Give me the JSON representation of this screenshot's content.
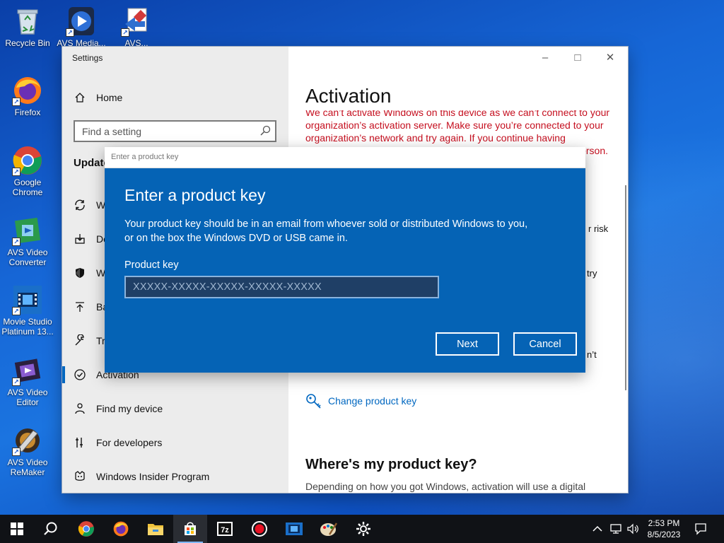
{
  "desktop": {
    "icons": [
      {
        "label": "Recycle Bin"
      },
      {
        "label": "AVS Media..."
      },
      {
        "label": "AVS..."
      },
      {
        "label": "Firefox"
      },
      {
        "label": "Google Chrome"
      },
      {
        "label": "AVS Video Converter"
      },
      {
        "label": "Movie Studio Platinum 13..."
      },
      {
        "label": "AVS Video Editor"
      },
      {
        "label": "AVS Video ReMaker"
      }
    ]
  },
  "settings": {
    "title": "Settings",
    "home": "Home",
    "search_placeholder": "Find a setting",
    "section": "Update",
    "nav": [
      {
        "label": "W",
        "icon": "sync-icon"
      },
      {
        "label": "De",
        "icon": "delivery-icon"
      },
      {
        "label": "W",
        "icon": "shield-icon"
      },
      {
        "label": "Ba",
        "icon": "backup-icon"
      },
      {
        "label": "Tr",
        "icon": "wrench-icon"
      },
      {
        "label": "Activation",
        "icon": "check-circle-icon"
      },
      {
        "label": "Find my device",
        "icon": "person-icon"
      },
      {
        "label": "For developers",
        "icon": "developer-icon"
      },
      {
        "label": "Windows Insider Program",
        "icon": "insider-icon"
      }
    ],
    "page_title": "Activation",
    "error_lines": [
      "We can’t activate Windows on this device as we can’t connect to your",
      "organization’s activation server. Make sure you’re connected to your",
      "organization’s network and try again. If you continue having",
      "erson."
    ],
    "fragments": {
      "risk": "r risk",
      "try": "try",
      "dont": "n’t"
    },
    "change_key_link": "Change product key",
    "where_heading": "Where's my product key?",
    "where_text": "Depending on how you got Windows, activation will use a digital"
  },
  "dialog": {
    "window_title": "Enter a product key",
    "heading": "Enter a product key",
    "description_line1": "Your product key should be in an email from whoever sold or distributed Windows to you,",
    "description_line2": "or on the box the Windows DVD or USB came in.",
    "field_label": "Product key",
    "placeholder": "XXXXX-XXXXX-XXXXX-XXXXX-XXXXX",
    "next": "Next",
    "cancel": "Cancel"
  },
  "taskbar": {
    "time": "2:53 PM",
    "date": "8/5/2023",
    "apps": [
      "start-icon",
      "search-icon",
      "chrome-icon",
      "firefox-icon",
      "file-explorer-icon",
      "store-icon",
      "7zip-icon",
      "recorder-icon",
      "video-icon",
      "paint-icon",
      "settings-gear-icon"
    ]
  },
  "colors": {
    "accent": "#0067c0",
    "dialog_bg": "#0563b5",
    "error": "#c50f1f",
    "taskbar": "#101216"
  }
}
